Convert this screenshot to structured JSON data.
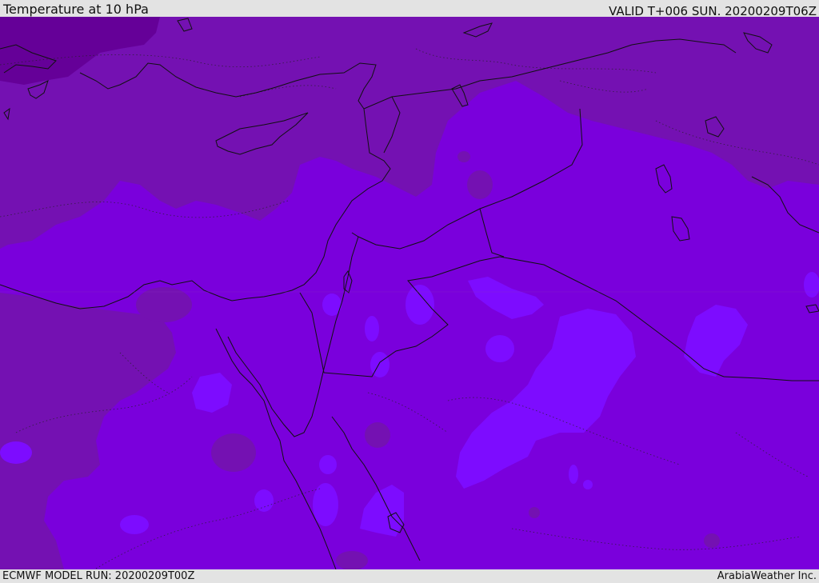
{
  "header": {
    "title": "Temperature at 10 hPa",
    "valid": "VALID T+006 SUN. 20200209T06Z"
  },
  "footer": {
    "model_run": "ECMWF MODEL RUN: 20200209T00Z",
    "credit": "ArabiaWeather Inc."
  },
  "map": {
    "field": "temperature",
    "level": "10 hPa",
    "colors": {
      "base": "#7a00dc",
      "darker": "#7411b2",
      "darkest": "#650098",
      "lighter": "#7d0cff",
      "lightest": "#8a1aff",
      "lines": "#111111"
    }
  }
}
